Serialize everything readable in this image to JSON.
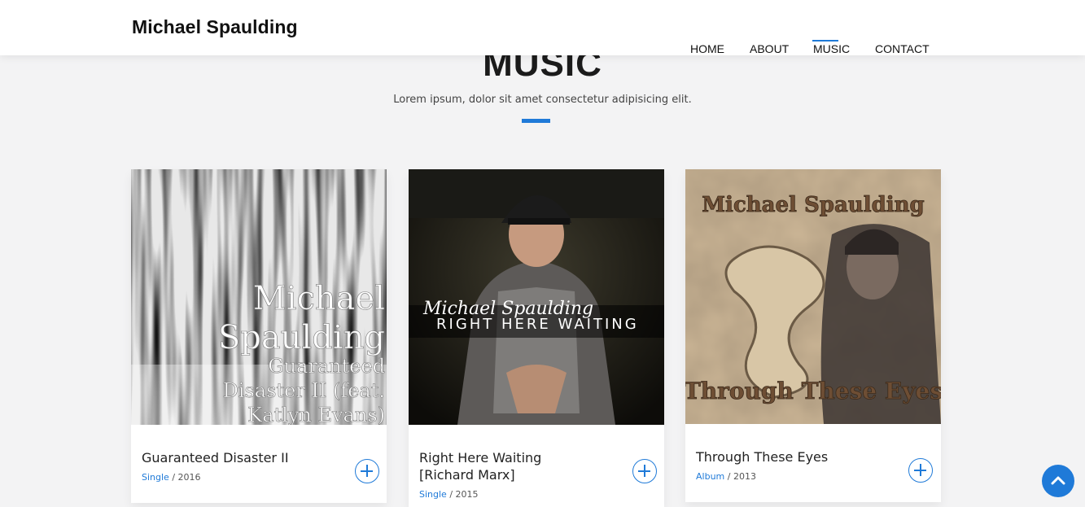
{
  "navbar": {
    "brand": "Michael Spaulding",
    "links": [
      "HOME",
      "ABOUT",
      "MUSIC",
      "CONTACT"
    ],
    "active": "MUSIC"
  },
  "section": {
    "title": "MUSIC",
    "subtitle": "Lorem ipsum, dolor sit amet consectetur adipisicing elit."
  },
  "cards": [
    {
      "title": "Guaranteed Disaster II",
      "type": "Single",
      "year": "2016",
      "cover_text": [
        "Michael",
        "Spaulding",
        "Guaranteed",
        "Disaster II (feat.",
        "Katlyn Evans)"
      ]
    },
    {
      "title_line1": "Right Here Waiting",
      "title_line2": "[Richard Marx]",
      "type": "Single",
      "year": "2015",
      "cover_script": "Michael Spaulding",
      "cover_caps": "RIGHT HERE WAITING"
    },
    {
      "title": "Through These Eyes",
      "type": "Album",
      "year": "2013",
      "cover_top": "Michael Spaulding",
      "cover_bottom": "Through These Eyes"
    }
  ],
  "colors": {
    "accent": "#1f7ad8",
    "background": "#f3f3f4"
  },
  "icons": [
    "plus-circle-icon",
    "chevron-up-icon"
  ]
}
